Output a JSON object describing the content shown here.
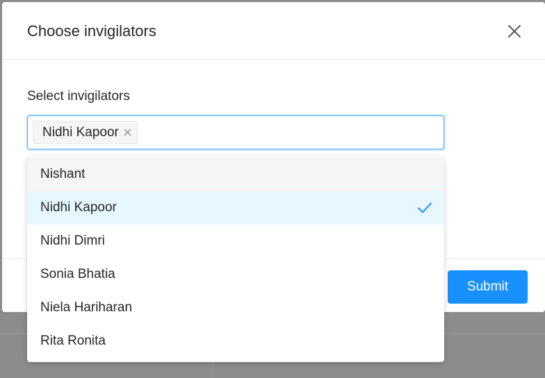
{
  "modal": {
    "title": "Choose invigilators",
    "close_icon": "close-icon"
  },
  "form": {
    "label": "Select invigilators",
    "selected_tags": [
      {
        "label": "Nidhi Kapoor",
        "remove_icon": "close-icon"
      }
    ]
  },
  "dropdown": {
    "options": [
      {
        "label": "Nishant",
        "state": "hovered"
      },
      {
        "label": "Nidhi Kapoor",
        "state": "selected"
      },
      {
        "label": "Nidhi Dimri",
        "state": "normal"
      },
      {
        "label": "Sonia Bhatia",
        "state": "normal"
      },
      {
        "label": "Niela Hariharan",
        "state": "normal"
      },
      {
        "label": "Rita Ronita",
        "state": "normal"
      }
    ],
    "selected_icon": "check-icon"
  },
  "footer": {
    "submit_label": "Submit"
  },
  "colors": {
    "primary": "#1890ff",
    "selected_bg": "#e6f7ff",
    "hover_bg": "#f5f5f5",
    "mask": "#8c8c8c"
  }
}
